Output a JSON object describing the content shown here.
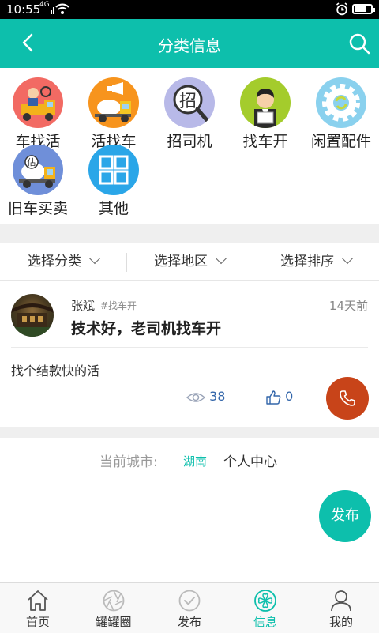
{
  "status_bar": {
    "time": "10:55",
    "network": "4G"
  },
  "header": {
    "title": "分类信息"
  },
  "categories": [
    {
      "label": "车找活",
      "icon": "truck-mechanic-icon"
    },
    {
      "label": "活找车",
      "icon": "mixer-truck-megaphone-icon"
    },
    {
      "label": "招司机",
      "icon": "hire-search-icon",
      "glyph": "招"
    },
    {
      "label": "找车开",
      "icon": "driver-job-icon"
    },
    {
      "label": "闲置配件",
      "icon": "gear-parts-icon"
    },
    {
      "label": "旧车买卖",
      "icon": "used-mixer-truck-icon",
      "glyph": "估"
    },
    {
      "label": "其他",
      "icon": "grid-icon"
    }
  ],
  "filters": [
    {
      "label": "选择分类"
    },
    {
      "label": "选择地区"
    },
    {
      "label": "选择排序"
    }
  ],
  "post": {
    "user": "张斌",
    "tag": "#找车开",
    "time": "14天前",
    "title": "技术好，老司机找车开",
    "content": "找个结款快的活",
    "views": "38",
    "likes": "0"
  },
  "footer": {
    "city_label": "当前城市:",
    "city": "湖南",
    "personal_center": "个人中心"
  },
  "publish_button": "发布",
  "tabs": [
    {
      "label": "首页",
      "icon": "home-icon"
    },
    {
      "label": "罐罐圈",
      "icon": "aperture-icon"
    },
    {
      "label": "发布",
      "icon": "publish-icon"
    },
    {
      "label": "信息",
      "icon": "info-clover-icon",
      "active": true
    },
    {
      "label": "我的",
      "icon": "user-icon"
    }
  ],
  "colors": {
    "primary": "#0dbfac",
    "call": "#c84419",
    "link": "#3366aa"
  }
}
